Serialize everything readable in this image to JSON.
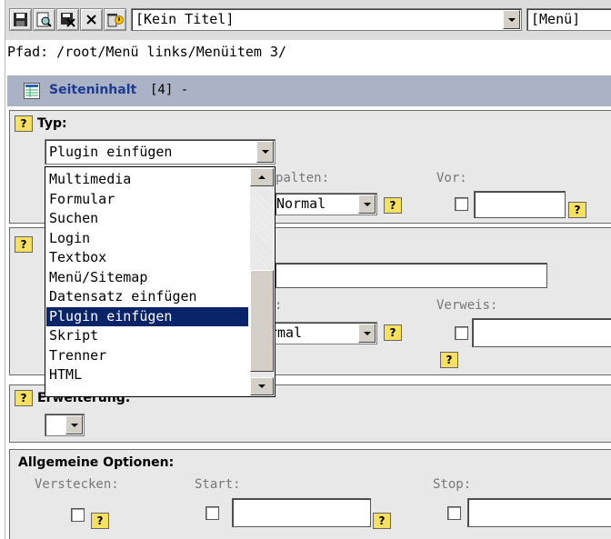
{
  "toolbar": {
    "icons": [
      "save-icon",
      "preview-icon",
      "save-close-icon",
      "close-icon",
      "delete-icon"
    ],
    "title_select": "[Kein Titel]",
    "menu_select": "[Menü]"
  },
  "path": "Pfad: /root/Menü links/Menüitem 3/",
  "page_header": {
    "title": "Seiteninhalt",
    "count": "[4] -"
  },
  "help_label": "?",
  "type_section": {
    "label": "Typ:",
    "selected": "Plugin einfügen",
    "columns_label": "palten:",
    "columns_value": "Normal",
    "before_label": "Vor:"
  },
  "dropdown": {
    "options": [
      "Multimedia",
      "Formular",
      "Suchen",
      "Login",
      "Textbox",
      "Menü/Sitemap",
      "Datensatz einfügen",
      "Plugin einfügen",
      "Skript",
      "Trenner",
      "HTML"
    ],
    "selected_index": 7
  },
  "header_section": {
    "partial_label": ":",
    "partial_value": "rmal",
    "link_label": "Verweis:"
  },
  "extension_section": {
    "label": "Erweiterung:"
  },
  "general_section": {
    "label": "Allgemeine Optionen:",
    "hide_label": "Verstecken:",
    "start_label": "Start:",
    "stop_label": "Stop:"
  },
  "colors": {
    "header_bg": "#aab3c5",
    "header_text": "#1e3a90",
    "selection": "#0a246a",
    "help_bg": "#f5e060"
  }
}
